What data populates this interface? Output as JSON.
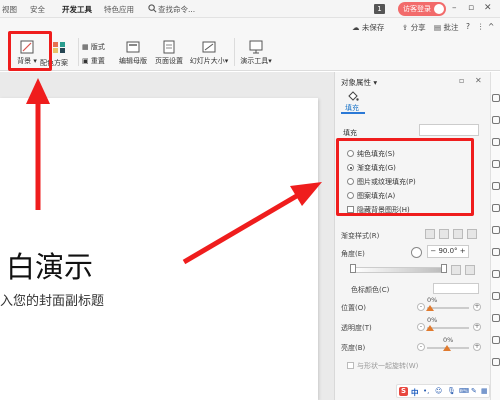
{
  "menu": {
    "tabs": [
      "视图",
      "安全",
      "开发工具",
      "特色应用"
    ],
    "search_placeholder": "查找命令...",
    "window_badge": "1",
    "login_label": "访客登录"
  },
  "quick_tools": {
    "unsaved": "未保存",
    "share": "分享",
    "comment": "批注",
    "help": "?",
    "more": "⋮",
    "collapse": "^"
  },
  "ribbon": {
    "background_label": "背景",
    "color_scheme_label": "配色方案",
    "layout_label": "版式",
    "reset_label": "重置",
    "edit_master_label": "编辑母版",
    "page_setup_label": "页面设置",
    "slide_size_label": "幻灯片大小",
    "presentation_tools_label": "演示工具"
  },
  "slide": {
    "title_visible": "白演示",
    "subtitle_visible": "入您的封面副标题"
  },
  "panel": {
    "title": "对象属性",
    "tab_fill": "填充",
    "section_fill": "填充",
    "options": [
      {
        "label": "纯色填充(S)",
        "checked": false
      },
      {
        "label": "渐变填充(G)",
        "checked": true
      },
      {
        "label": "图片或纹理填充(P)",
        "checked": false
      },
      {
        "label": "图案填充(A)",
        "checked": false
      }
    ],
    "hide_bg_label": "隐藏背景图形(H)",
    "gradient_style_label": "渐变样式(R)",
    "angle_label": "角度(E)",
    "angle_value": "90.0°",
    "color_label": "色标颜色(C)",
    "position_label": "位置(O)",
    "position_value": "0%",
    "transparency_label": "透明度(T)",
    "transparency_value": "0%",
    "brightness_label": "亮度(B)",
    "brightness_value": "0%",
    "rotate_label": "与形状一起旋转(W)"
  },
  "ime": {
    "brand": "S",
    "mode": "中"
  },
  "colors": {
    "annotation_red": "#ef1d1d",
    "login_red": "#f26b6b",
    "fill_tab_blue": "#1a73c7",
    "slider_orange": "#e07a2e"
  }
}
